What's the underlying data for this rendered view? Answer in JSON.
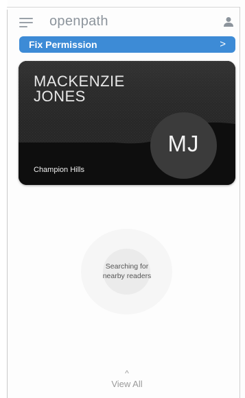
{
  "header": {
    "brand": "openpath",
    "menu_icon": "hamburger-menu-icon",
    "user_icon": "user-icon"
  },
  "banner": {
    "label": "Fix Permission",
    "chevron": ">",
    "color": "#3d8bd6"
  },
  "card": {
    "first_name": "MACKENZIE",
    "last_name": "JONES",
    "location": "Champion Hills",
    "initials": "MJ"
  },
  "status": {
    "line1": "Searching for",
    "line2": "nearby readers"
  },
  "footer": {
    "chevron": "^",
    "view_all": "View All"
  }
}
